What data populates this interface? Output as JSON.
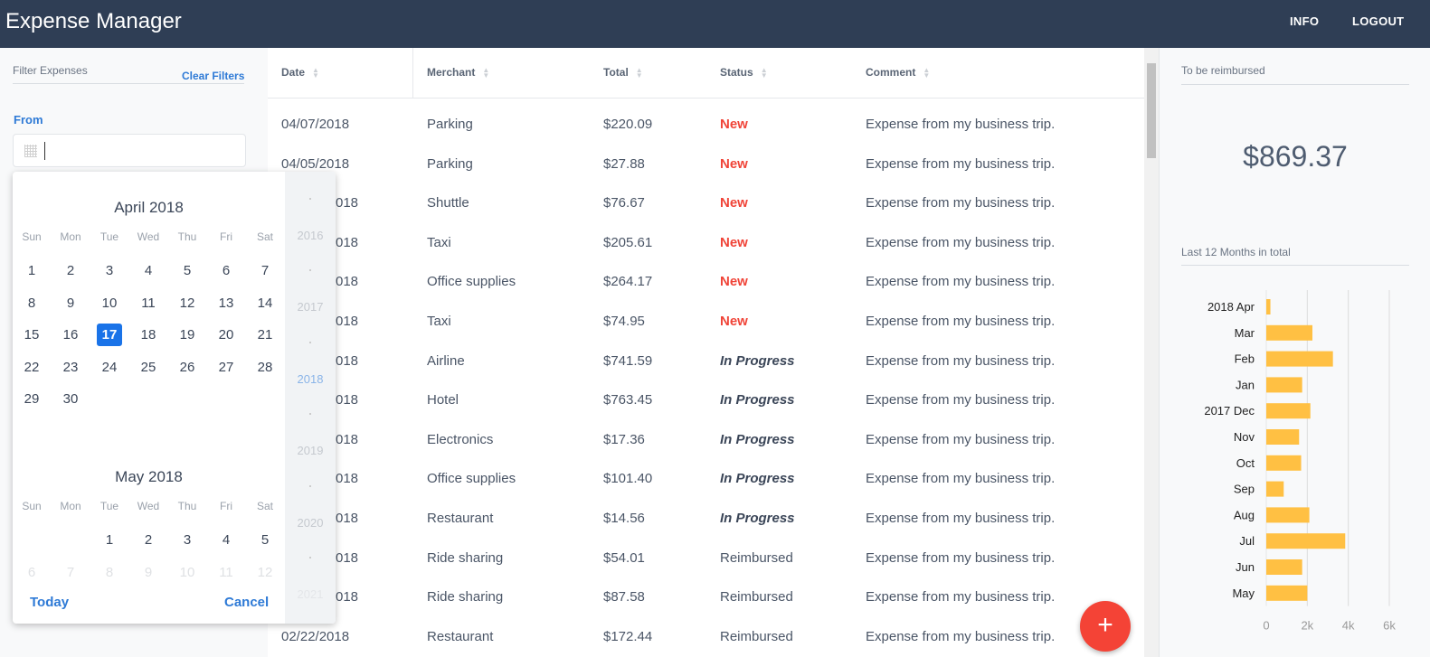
{
  "header": {
    "title": "Expense Manager",
    "info": "INFO",
    "logout": "LOGOUT"
  },
  "filters": {
    "title": "Filter Expenses",
    "clear": "Clear Filters",
    "from_label": "From",
    "from_value": ""
  },
  "datepicker": {
    "dow": [
      "Sun",
      "Mon",
      "Tue",
      "Wed",
      "Thu",
      "Fri",
      "Sat"
    ],
    "months": [
      {
        "title": "April 2018",
        "start_dow": 0,
        "days": 30,
        "selected": 17,
        "faded_from": 0
      },
      {
        "title": "May 2018",
        "start_dow": 2,
        "days": 12,
        "selected": 0,
        "faded_from": 6
      }
    ],
    "years": [
      "2016",
      "2017",
      "2018",
      "2019",
      "2020",
      "2021"
    ],
    "active_year": "2018",
    "today": "Today",
    "cancel": "Cancel"
  },
  "table": {
    "columns": [
      "Date",
      "Merchant",
      "Total",
      "Status",
      "Comment"
    ],
    "rows": [
      {
        "date": "04/07/2018",
        "merchant": "Parking",
        "total": "$220.09",
        "status": "New",
        "comment": "Expense from my business trip."
      },
      {
        "date": "04/05/2018",
        "merchant": "Parking",
        "total": "$27.88",
        "status": "New",
        "comment": "Expense from my business trip."
      },
      {
        "date": "018",
        "merchant": "Shuttle",
        "total": "$76.67",
        "status": "New",
        "comment": "Expense from my business trip."
      },
      {
        "date": "018",
        "merchant": "Taxi",
        "total": "$205.61",
        "status": "New",
        "comment": "Expense from my business trip."
      },
      {
        "date": "018",
        "merchant": "Office supplies",
        "total": "$264.17",
        "status": "New",
        "comment": "Expense from my business trip."
      },
      {
        "date": "018",
        "merchant": "Taxi",
        "total": "$74.95",
        "status": "New",
        "comment": "Expense from my business trip."
      },
      {
        "date": "018",
        "merchant": "Airline",
        "total": "$741.59",
        "status": "In Progress",
        "comment": "Expense from my business trip."
      },
      {
        "date": "018",
        "merchant": "Hotel",
        "total": "$763.45",
        "status": "In Progress",
        "comment": "Expense from my business trip."
      },
      {
        "date": "018",
        "merchant": "Electronics",
        "total": "$17.36",
        "status": "In Progress",
        "comment": "Expense from my business trip."
      },
      {
        "date": "018",
        "merchant": "Office supplies",
        "total": "$101.40",
        "status": "In Progress",
        "comment": "Expense from my business trip."
      },
      {
        "date": "018",
        "merchant": "Restaurant",
        "total": "$14.56",
        "status": "In Progress",
        "comment": "Expense from my business trip."
      },
      {
        "date": "018",
        "merchant": "Ride sharing",
        "total": "$54.01",
        "status": "Reimbursed",
        "comment": "Expense from my business trip."
      },
      {
        "date": "018",
        "merchant": "Ride sharing",
        "total": "$87.58",
        "status": "Reimbursed",
        "comment": "Expense from my business trip."
      },
      {
        "date": "02/22/2018",
        "merchant": "Restaurant",
        "total": "$172.44",
        "status": "Reimbursed",
        "comment": "Expense from my business trip."
      }
    ]
  },
  "fab": {
    "icon": "plus-icon",
    "label": "+"
  },
  "summary": {
    "reimburse_label": "To be reimbursed",
    "reimburse_amount": "$869.37",
    "chart_label": "Last 12 Months in total"
  },
  "colors": {
    "header": "#2f3e55",
    "accent": "#2e7ad6",
    "new": "#f04438",
    "bar": "#ffc043",
    "fab": "#f44336"
  },
  "chart_data": {
    "type": "bar",
    "orientation": "horizontal",
    "categories": [
      "2018 Apr",
      "Mar",
      "Feb",
      "Jan",
      "2017 Dec",
      "Nov",
      "Oct",
      "Sep",
      "Aug",
      "Jul",
      "Jun",
      "May"
    ],
    "values": [
      200,
      2250,
      3250,
      1750,
      2150,
      1600,
      1700,
      850,
      2100,
      3850,
      1750,
      2000
    ],
    "xlim": [
      0,
      6000
    ],
    "xticks": [
      "0",
      "2k",
      "4k",
      "6k"
    ],
    "grid": true
  }
}
